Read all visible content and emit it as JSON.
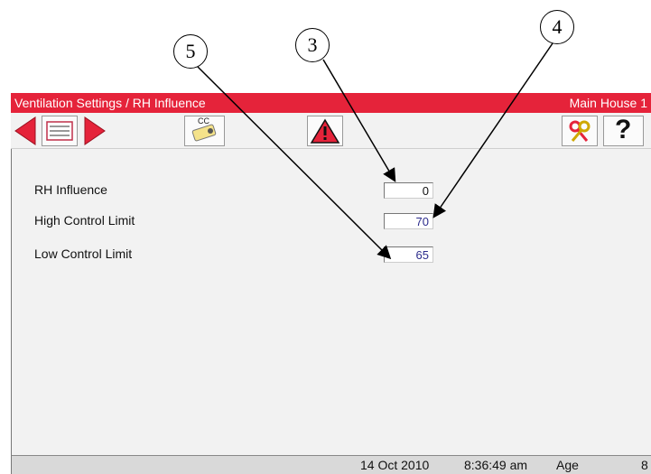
{
  "callouts": [
    "5",
    "3",
    "4"
  ],
  "titlebar": {
    "title": "Ventilation Settings / RH Influence",
    "house": "Main House 1"
  },
  "toolbar": {
    "cc_label": "CC",
    "help_label": "?"
  },
  "fields": [
    {
      "label": "RH Influence",
      "value": "0"
    },
    {
      "label": "High Control Limit",
      "value": "70"
    },
    {
      "label": "Low Control Limit",
      "value": "65"
    }
  ],
  "status": {
    "date": "14 Oct 2010",
    "time": "8:36:49 am",
    "age_label": "Age",
    "age_value": "8"
  },
  "colors": {
    "title_bar": "#e5233a",
    "arrow": "#e5233a",
    "value_text": "#2c2c8c"
  }
}
